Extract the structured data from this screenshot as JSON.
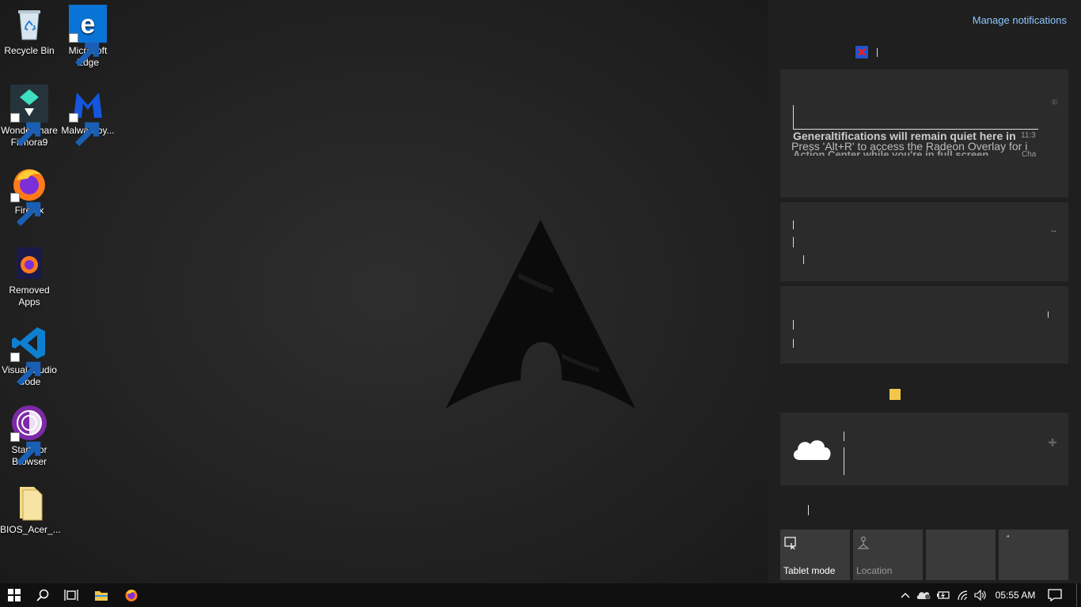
{
  "desktop": {
    "icons": [
      {
        "label": "Recycle Bin"
      },
      {
        "label": "Microsoft Edge"
      },
      {
        "label": "Wondershare Filmora9"
      },
      {
        "label": "Malwareby..."
      },
      {
        "label": "Firefox"
      },
      {
        "label": "Removed Apps"
      },
      {
        "label": "Visual Studio Code"
      },
      {
        "label": "Start Tor Browser"
      },
      {
        "label": "BIOS_Acer_..."
      }
    ]
  },
  "action_center": {
    "manage_notifications": "Manage notifications",
    "notification_1": {
      "title": "Generaltifications will remain quiet here in",
      "body": "Press 'Alt+R' to access the Radeon Overlay for i",
      "body2": "Action Center while you're in full screen",
      "time": "11:3",
      "extra": "Cha"
    },
    "quick_actions": [
      {
        "label": "Tablet mode"
      },
      {
        "label": "Location"
      },
      {
        "label": ""
      },
      {
        "label": ""
      }
    ]
  },
  "taskbar": {
    "time": "05:55 AM"
  },
  "colors": {
    "desktop_bg": "#232323",
    "action_center_bg": "#1f1f1f",
    "card_bg": "#2b2b2b",
    "tile_bg": "#3a3a3a",
    "link": "#8cc8ff",
    "taskbar_bg": "#101010"
  }
}
